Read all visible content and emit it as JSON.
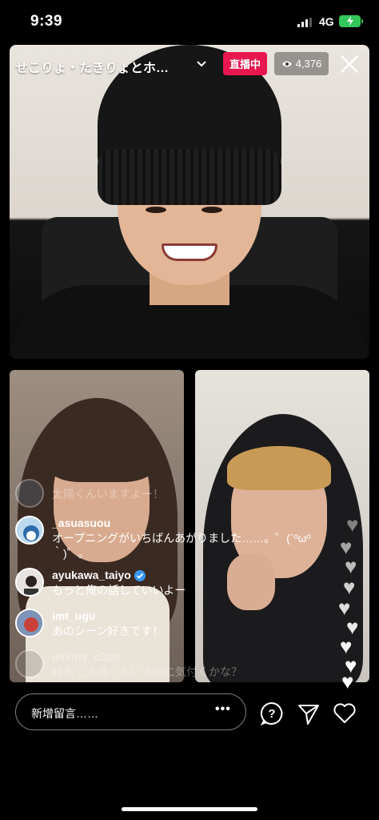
{
  "status_bar": {
    "time": "9:39",
    "network": "4G"
  },
  "header": {
    "title": "せこりょ・たきりょとホ…",
    "live_label": "直播中",
    "viewer_count": "4,376"
  },
  "comments": [
    {
      "username": "",
      "message": "太陽くんいますよー！",
      "faded": true
    },
    {
      "username": "_asuasuou",
      "message": "オープニングがいちばんあがりました……。゜(´ºωº｀)゜。",
      "faded": false
    },
    {
      "username": "ayukawa_taiyo",
      "verified": true,
      "message": "もっと俺の話していいよー",
      "faded": false
    },
    {
      "username": "imt_ugu",
      "message": "あのシーン好きです！",
      "faded": false
    },
    {
      "username": "mikitty_c3po",
      "message": "時差で太陽くんいるのに気付くかな？",
      "faded": true
    }
  ],
  "composer": {
    "placeholder": "新增留言……",
    "more": "•••"
  },
  "colors": {
    "live_badge": "#e8174f",
    "battery": "#34c759",
    "verified": "#3897f0"
  },
  "icons": [
    "chevron-down-icon",
    "eye-icon",
    "close-icon",
    "question-icon",
    "send-icon",
    "heart-icon",
    "verified-icon"
  ]
}
